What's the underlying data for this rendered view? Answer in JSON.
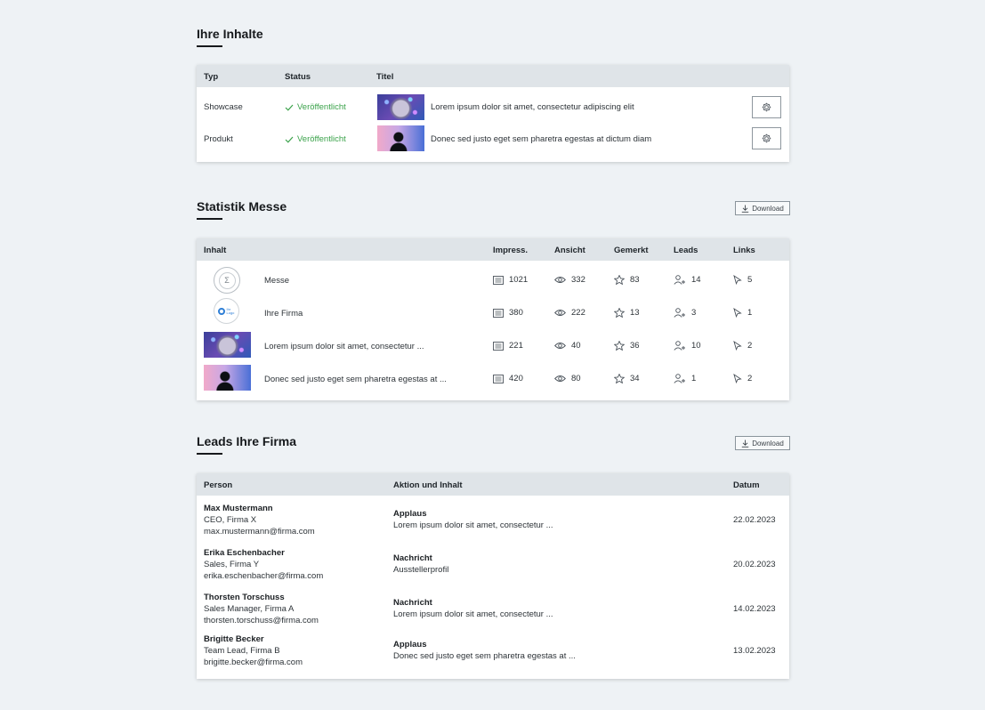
{
  "content": {
    "title": "Ihre Inhalte",
    "columns": {
      "typ": "Typ",
      "status": "Status",
      "titel": "Titel"
    },
    "rows": [
      {
        "typ": "Showcase",
        "status": "Veröffentlicht",
        "titel": "Lorem ipsum dolor sit amet, consectetur adipiscing elit",
        "thumb": "sphere",
        "action_icon": "gear-icon"
      },
      {
        "typ": "Produkt",
        "status": "Veröffentlicht",
        "titel": "Donec sed justo eget sem pharetra egestas at dictum diam",
        "thumb": "person",
        "action_icon": "gear-icon"
      }
    ]
  },
  "stats": {
    "title": "Statistik Messe",
    "download_label": "Download",
    "columns": {
      "inhalt": "Inhalt",
      "impress": "Impress.",
      "ansicht": "Ansicht",
      "gemerkt": "Gemerkt",
      "leads": "Leads",
      "links": "Links"
    },
    "rows": [
      {
        "label": "Messe",
        "thumb": "messe-logo",
        "impress": "1021",
        "ansicht": "332",
        "gemerkt": "83",
        "leads": "14",
        "links": "5"
      },
      {
        "label": "Ihre Firma",
        "thumb": "company-logo",
        "logo_text": "Ihr Logo",
        "impress": "380",
        "ansicht": "222",
        "gemerkt": "13",
        "leads": "3",
        "links": "1"
      },
      {
        "label": "Lorem ipsum dolor sit amet, consectetur ...",
        "thumb": "sphere",
        "impress": "221",
        "ansicht": "40",
        "gemerkt": "36",
        "leads": "10",
        "links": "2"
      },
      {
        "label": "Donec sed justo eget sem pharetra egestas at ...",
        "thumb": "person",
        "impress": "420",
        "ansicht": "80",
        "gemerkt": "34",
        "leads": "1",
        "links": "2"
      }
    ]
  },
  "leads": {
    "title": "Leads Ihre Firma",
    "download_label": "Download",
    "columns": {
      "person": "Person",
      "aktion": "Aktion und Inhalt",
      "datum": "Datum"
    },
    "rows": [
      {
        "name": "Max Mustermann",
        "role": "CEO, Firma X",
        "email": "max.mustermann@firma.com",
        "action": "Applaus",
        "content": "Lorem ipsum dolor sit amet, consectetur ...",
        "date": "22.02.2023"
      },
      {
        "name": "Erika Eschenbacher",
        "role": "Sales, Firma Y",
        "email": "erika.eschenbacher@firma.com",
        "action": "Nachricht",
        "content": "Ausstellerprofil",
        "date": "20.02.2023"
      },
      {
        "name": "Thorsten Torschuss",
        "role": "Sales Manager, Firma A",
        "email": "thorsten.torschuss@firma.com",
        "action": "Nachricht",
        "content": "Lorem ipsum dolor sit amet, consectetur ...",
        "date": "14.02.2023"
      },
      {
        "name": "Brigitte Becker",
        "role": "Team Lead, Firma B",
        "email": "brigitte.becker@firma.com",
        "action": "Applaus",
        "content": "Donec sed justo eget sem pharetra egestas at ...",
        "date": "13.02.2023"
      }
    ]
  },
  "colors": {
    "background": "#eef2f5",
    "header": "#dfe4e8",
    "published": "#3aa24a"
  }
}
